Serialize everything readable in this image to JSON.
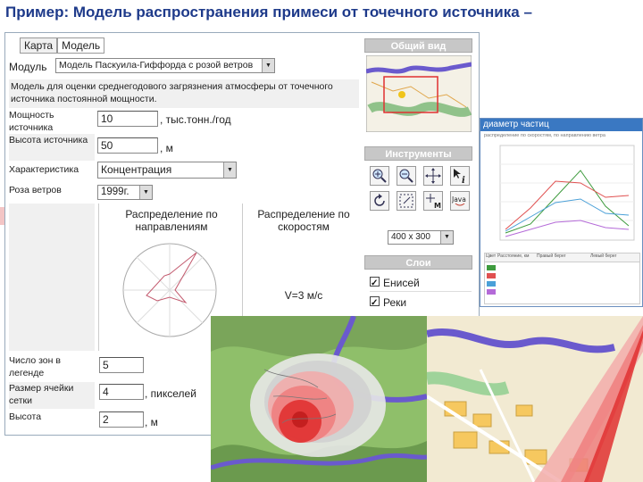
{
  "slide_title": "Пример: Модель распространения примеси от точечного источника –",
  "tabs": [
    {
      "label": "Карта"
    },
    {
      "label": "Модель"
    }
  ],
  "form": {
    "model_label": "Модуль",
    "model_value": "Модель Паскуила-Гиффорда с розой ветров",
    "description": "Модель для оценки среднегодового загрязнения атмосферы от точечного источника постоянной мощности.",
    "power_label": "Мощность источника",
    "power_value": "10",
    "power_unit": ", тыс.тонн./год",
    "height_label": "Высота источника",
    "height_value": "50",
    "height_unit": ", м",
    "char_label": "Характеристика",
    "char_value": "Концентрация",
    "rose_label": "Роза ветров",
    "rose_value": "1999г.",
    "dist_dir": "Распределение по направлениям",
    "dist_speed": "Распределение по скоростям",
    "wind_speed": "V=3 м/с",
    "zones_label": "Число зон в легенде",
    "zones_value": "5",
    "cell_label": "Размер ячейки сетки",
    "cell_value": "4",
    "cell_unit": ", пикселей",
    "hgt_label": "Высота",
    "hgt_value": "2",
    "hgt_unit": ", м"
  },
  "right_panel": {
    "overview_header": "Общий вид",
    "tools_header": "Инструменты",
    "size_value": "400 x 300",
    "layers_header": "Слои",
    "layers": [
      {
        "label": "Енисей"
      },
      {
        "label": "Реки"
      }
    ],
    "java_label": "Java"
  },
  "chart_window": {
    "title": "диаметр частиц",
    "subtitle": "распределение по скоростям, по направлению ветра",
    "table_headers": [
      "Цвет",
      "Расстояние, км",
      "Правый берег",
      "Левый берег"
    ]
  },
  "colors": {
    "slide_title": "#1e3a8a",
    "header_gray": "#c7c7c7",
    "chart_title_bar": "#3a78c2",
    "plume_red": "#e03131",
    "map_green": "#3e9b3e",
    "river_purple": "#6a5acd"
  }
}
